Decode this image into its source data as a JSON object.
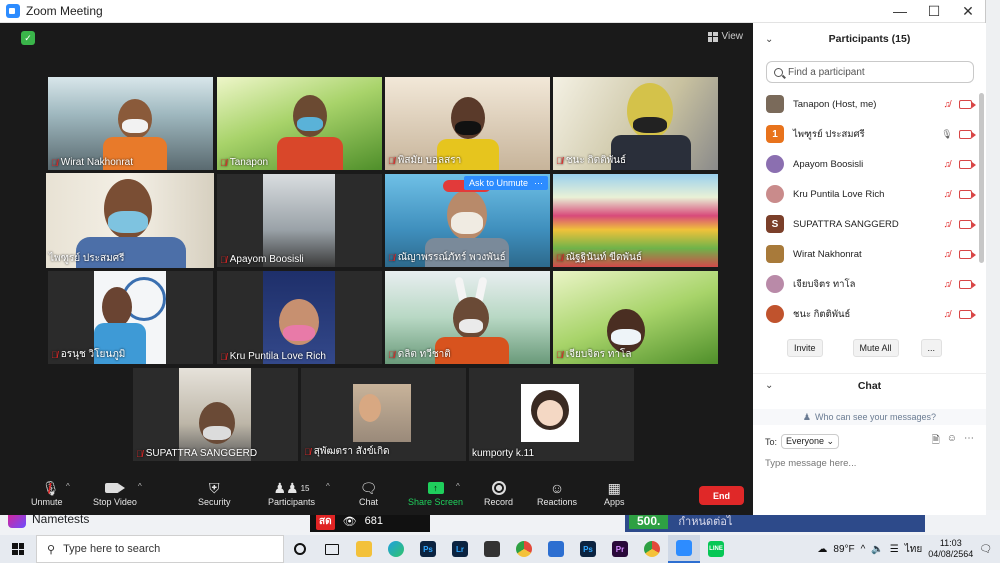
{
  "window": {
    "title": "Zoom Meeting"
  },
  "view_label": "View",
  "tiles": [
    {
      "name": "Wirat Nakhonrat",
      "muted": true
    },
    {
      "name": "Tanapon",
      "muted": true
    },
    {
      "name": "พิสมัย บอลสรา",
      "muted": true
    },
    {
      "name": "ชนะ กิตติพันธ์",
      "muted": true
    },
    {
      "name": "ไพฑูรย์ ประสมศรี",
      "muted": false
    },
    {
      "name": "Apayom Boosisli",
      "muted": true
    },
    {
      "name": "ณัญาพรรณ์ภัทร์ พวงพันธ์",
      "muted": true
    },
    {
      "name": "ณัฐฐินันท์ ขีดพันธ์",
      "muted": true
    },
    {
      "name": "อรนุช วิโยนภูมิ",
      "muted": true
    },
    {
      "name": "Kru Puntila Love Rich",
      "muted": true
    },
    {
      "name": "ดลิต ทวีชาติ",
      "muted": true
    },
    {
      "name": "เจียบจิตร ทาโล",
      "muted": true
    },
    {
      "name": "SUPATTRA SANGGERD",
      "muted": true
    },
    {
      "name": "สุพัฒตรา สังข์เกิด",
      "muted": true
    },
    {
      "name": "kumporty k.11",
      "muted": false
    }
  ],
  "ask_to_unmute": "Ask to Unmute",
  "toolbar": {
    "unmute": "Unmute",
    "stop_video": "Stop Video",
    "security": "Security",
    "participants": "Participants",
    "participants_count": "15",
    "chat": "Chat",
    "share_screen": "Share Screen",
    "record": "Record",
    "reactions": "Reactions",
    "apps": "Apps",
    "end": "End"
  },
  "panel": {
    "title": "Participants (15)",
    "search_placeholder": "Find a participant",
    "participants": [
      {
        "name": "Tanapon (Host, me)",
        "avatar_letter": "",
        "avatar_color": "#7a6a5a",
        "mic_on": false
      },
      {
        "name": "ไพฑูรย์ ประสมศรี",
        "avatar_letter": "1",
        "avatar_color": "#e8731c",
        "mic_on": true
      },
      {
        "name": "Apayom Boosisli",
        "avatar_letter": "",
        "avatar_color": "#8b6fb0",
        "mic_on": false
      },
      {
        "name": "Kru Puntila Love Rich",
        "avatar_letter": "",
        "avatar_color": "#c98b8b",
        "mic_on": false
      },
      {
        "name": "SUPATTRA SANGGERD",
        "avatar_letter": "S",
        "avatar_color": "#7b3f2a",
        "mic_on": false
      },
      {
        "name": "Wirat Nakhonrat",
        "avatar_letter": "",
        "avatar_color": "#a87a3a",
        "mic_on": false
      },
      {
        "name": "เจียบจิตร ทาโล",
        "avatar_letter": "",
        "avatar_color": "#b98aa8",
        "mic_on": false
      },
      {
        "name": "ชนะ กิตติพันธ์",
        "avatar_letter": "",
        "avatar_color": "#c0532d",
        "mic_on": false
      }
    ],
    "invite": "Invite",
    "mute_all": "Mute All",
    "more": "...",
    "chat_title": "Chat",
    "who_can_see": "Who can see your messages?",
    "to_label": "To:",
    "to_value": "Everyone",
    "message_placeholder": "Type message here..."
  },
  "background": {
    "app_name": "Nametests",
    "live_badge": "สด",
    "views": "681",
    "score": "500.",
    "right_text": "กำหนดต่อไ"
  },
  "taskbar": {
    "search_placeholder": "Type here to search",
    "temperature": "89°F",
    "lang": "ไทย",
    "time": "11:03",
    "date": "04/08/2564"
  }
}
